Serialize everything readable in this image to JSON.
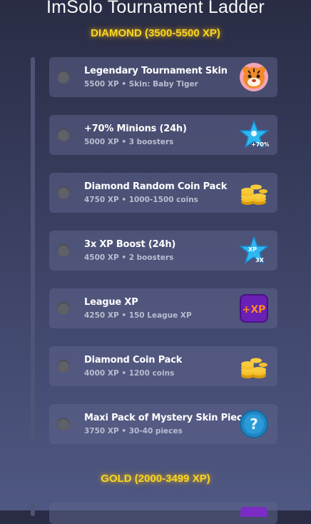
{
  "page": {
    "title": "ImSolo Tournament Ladder"
  },
  "tiers": {
    "diamond": {
      "label": "DIAMOND (3500-5500 XP)"
    },
    "gold": {
      "label": "GOLD (2000-3499 XP)"
    }
  },
  "rewards": [
    {
      "name": "Legendary Tournament Skin",
      "detail": "5500 XP • Skin: Baby Tiger",
      "icon": "tiger-skin-icon",
      "claimed": false
    },
    {
      "name": "+70% Minions (24h)",
      "detail": "5000 XP • 3 boosters",
      "icon": "minion-booster-star-icon",
      "badge": "+70%",
      "claimed": false
    },
    {
      "name": "Diamond Random Coin Pack",
      "detail": "4750 XP • 1000-1500 coins",
      "icon": "coin-stack-icon",
      "claimed": false
    },
    {
      "name": "3x XP Boost (24h)",
      "detail": "4500 XP • 2 boosters",
      "icon": "xp-boost-star-icon",
      "badge": "3X",
      "badge_top": "XP",
      "claimed": false
    },
    {
      "name": "League XP",
      "detail": "4250 XP • 150 League XP",
      "icon": "league-xp-icon",
      "badge": "+XP",
      "claimed": false
    },
    {
      "name": "Diamond Coin Pack",
      "detail": "4000 XP • 1200 coins",
      "icon": "coin-stack-icon",
      "claimed": false
    },
    {
      "name": "Maxi Pack of Mystery Skin Pieces",
      "detail": "3750 XP • 30-40 pieces",
      "icon": "mystery-skin-icon",
      "badge": "?",
      "claimed": false
    }
  ],
  "colors": {
    "tier_label": "#f9d423",
    "card": "#5c638a",
    "status_dot": "#606068",
    "subtext": "#b9bdd0"
  }
}
